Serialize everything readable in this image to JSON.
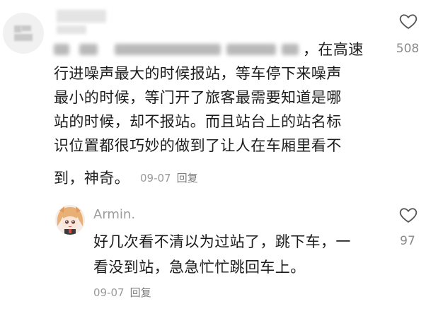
{
  "comment": {
    "avatar": "blurred-avatar",
    "username": "",
    "lines": [
      "，在高速",
      "行进噪声最大的时候报站，等车停下来噪声",
      "最小的时候，等门开了旅客最需要知道是哪",
      "站的时候，却不报站。而且站台上的站名标",
      "识位置都很巧妙的做到了让人在车厢里看不",
      "到，神奇。"
    ],
    "date": "09-07",
    "reply_label": "回复",
    "likes": "508",
    "like_icon": "heart-outline-icon"
  },
  "reply": {
    "avatar": "anime-avatar",
    "username": "Armin.",
    "lines": [
      "好几次看不清以为过站了，跳下车，一",
      "看没到站，急急忙忙跳回车上。"
    ],
    "date": "09-07",
    "reply_label": "回复",
    "likes": "97",
    "like_icon": "heart-outline-icon"
  },
  "colors": {
    "text": "#1b1b1b",
    "meta": "#9a9a9a",
    "icon": "#555555"
  }
}
